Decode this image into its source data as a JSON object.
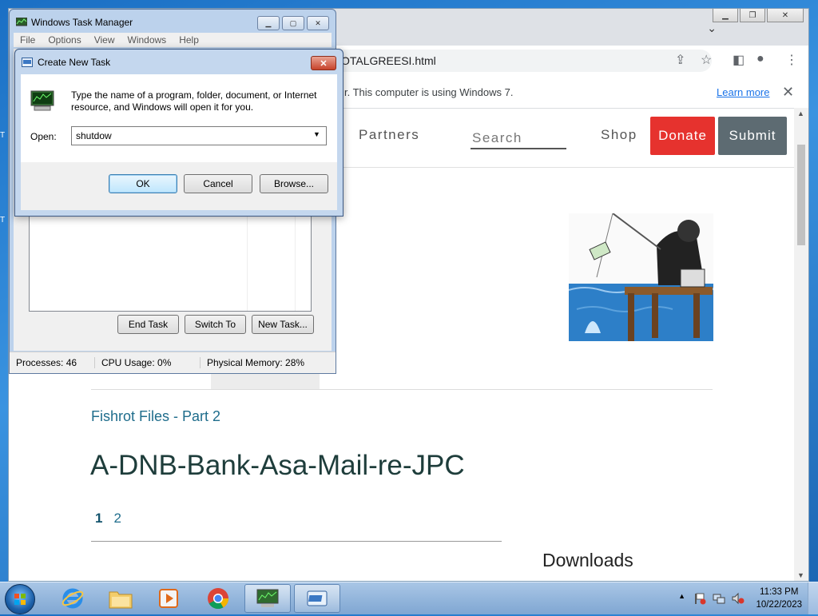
{
  "browser": {
    "url": "OTALGREESI.html",
    "infobar_message": "r. This computer is using Windows 7.",
    "infobar_link": "Learn more",
    "infobar_close": "✕"
  },
  "site": {
    "nav_partners": "Partners",
    "nav_search_placeholder": "Search",
    "nav_shop": "Shop",
    "donate_label": "Donate",
    "submit_label": "Submit",
    "breadcrumb": "Fishrot Files - Part 2",
    "title": "A-DNB-Bank-Asa-Mail-re-JPC",
    "pages": [
      "1",
      "2"
    ],
    "downloads_heading": "Downloads",
    "donate_color": "#e6322e",
    "submit_color": "#5d6b72"
  },
  "taskmgr": {
    "title": "Windows Task Manager",
    "menu": [
      "File",
      "Options",
      "View",
      "Windows",
      "Help"
    ],
    "buttons": {
      "end_task": "End Task",
      "switch_to": "Switch To",
      "new_task": "New Task..."
    },
    "status": {
      "processes": "Processes: 46",
      "cpu": "CPU Usage: 0%",
      "memory": "Physical Memory: 28%"
    }
  },
  "dialog": {
    "title": "Create New Task",
    "description": "Type the name of a program, folder, document, or Internet resource, and Windows will open it for you.",
    "open_label": "Open:",
    "open_value": "shutdow",
    "ok": "OK",
    "cancel": "Cancel",
    "browse": "Browse..."
  },
  "taskbar": {
    "apps": [
      "internet-explorer-icon",
      "file-explorer-icon",
      "media-player-icon",
      "chrome-icon",
      "task-manager-icon",
      "run-dialog-icon"
    ],
    "time": "11:33 PM",
    "date": "10/22/2023",
    "tray_arrow": "▲"
  }
}
